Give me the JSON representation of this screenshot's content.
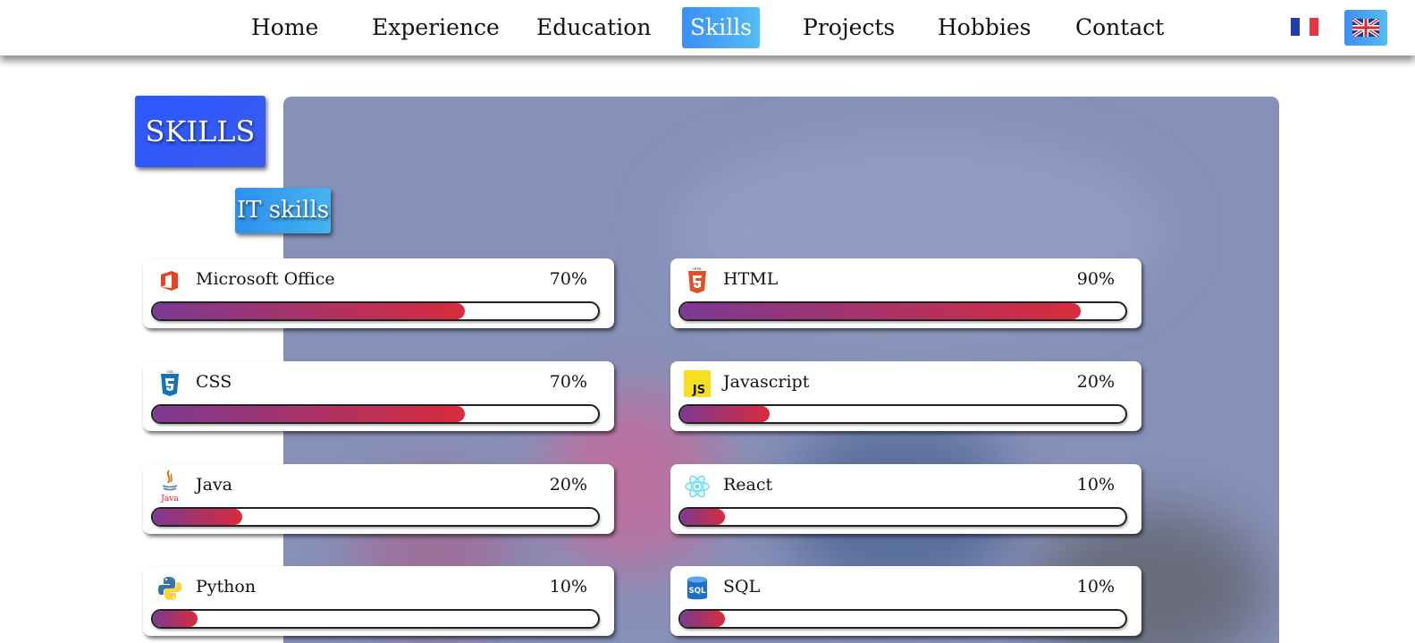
{
  "nav": {
    "items": [
      {
        "label": "Home",
        "active": false
      },
      {
        "label": "Experience",
        "active": false
      },
      {
        "label": "Education",
        "active": false
      },
      {
        "label": "Skills",
        "active": true
      },
      {
        "label": "Projects",
        "active": false
      },
      {
        "label": "Hobbies",
        "active": false
      },
      {
        "label": "Contact",
        "active": false
      }
    ],
    "languages": [
      {
        "icon": "flag-fr-icon",
        "selected": false
      },
      {
        "icon": "flag-uk-icon",
        "selected": true
      }
    ]
  },
  "section": {
    "title": "SKILLS",
    "subtitle": "IT skills"
  },
  "skills": [
    {
      "name": "Microsoft Office",
      "percent_label": "70%",
      "level": 0.7,
      "icon": "microsoft-office-icon"
    },
    {
      "name": "HTML",
      "percent_label": "90%",
      "level": 0.9,
      "icon": "html5-icon"
    },
    {
      "name": "CSS",
      "percent_label": "70%",
      "level": 0.7,
      "icon": "css3-icon"
    },
    {
      "name": "Javascript",
      "percent_label": "20%",
      "level": 0.2,
      "icon": "javascript-icon"
    },
    {
      "name": "Java",
      "percent_label": "20%",
      "level": 0.2,
      "icon": "java-icon"
    },
    {
      "name": "React",
      "percent_label": "10%",
      "level": 0.1,
      "icon": "react-icon"
    },
    {
      "name": "Python",
      "percent_label": "10%",
      "level": 0.1,
      "icon": "python-icon"
    },
    {
      "name": "SQL",
      "percent_label": "10%",
      "level": 0.1,
      "icon": "sql-icon"
    }
  ],
  "colors": {
    "accent": "#3c8ef5",
    "title_bg": "#2b58ff",
    "bar_start": "#7b3a92",
    "bar_end": "#d92b3c"
  }
}
